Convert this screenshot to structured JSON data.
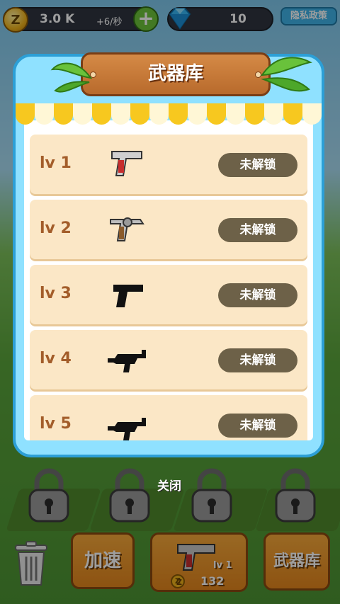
{
  "hud": {
    "coins": "3.0 K",
    "coin_rate": "+6/秒",
    "coin_symbol": "Z",
    "gems": "10",
    "privacy_label": "隐私政策"
  },
  "modal": {
    "title": "武器库",
    "weapons": [
      {
        "level": "lv 1",
        "status": "未解锁",
        "icon": "pistol-red-icon"
      },
      {
        "level": "lv 2",
        "status": "未解锁",
        "icon": "revolver-icon"
      },
      {
        "level": "lv 3",
        "status": "未解锁",
        "icon": "pistol-silhouette-icon"
      },
      {
        "level": "lv 4",
        "status": "未解锁",
        "icon": "smg-silhouette-icon"
      },
      {
        "level": "lv 5",
        "status": "未解锁",
        "icon": "smg-silhouette-icon"
      }
    ]
  },
  "bottom": {
    "close_label": "关闭",
    "speed_label": "加速",
    "armory_label": "武器库",
    "buy": {
      "level": "lv 1",
      "cost": "132",
      "coin_symbol": "Z"
    }
  }
}
